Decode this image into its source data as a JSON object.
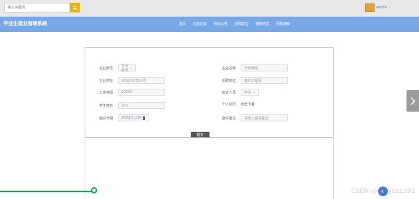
{
  "search": {
    "placeholder": "输入关键词"
  },
  "user": {
    "name": "admin"
  },
  "nav": {
    "brand": "毕业生就业管理系统",
    "items": [
      "首页",
      "交流论坛",
      "网站公告",
      "招聘职位",
      "招聘信息",
      "招聘通知"
    ]
  },
  "form": {
    "left": [
      {
        "label": "企业账号",
        "type": "select",
        "value": "企业账号"
      },
      {
        "label": "企业地址",
        "type": "text",
        "value": "XX省XX市XX号"
      },
      {
        "label": "工资待遇",
        "type": "text",
        "value": "10000"
      },
      {
        "label": "学生姓名",
        "type": "text",
        "value": "张三"
      },
      {
        "label": "面试日期",
        "type": "date",
        "value": "2023/11/16"
      }
    ],
    "right": [
      {
        "label": "企业名称",
        "type": "text",
        "value": "华软网络"
      },
      {
        "label": "招聘岗位",
        "type": "text",
        "value": "软件工程师"
      },
      {
        "label": "面试人员",
        "type": "select",
        "value": "学生"
      },
      {
        "label": "个人简历",
        "type": "link",
        "value": "点击下载"
      },
      {
        "label": "面试备注",
        "type": "text",
        "value": "请输入面试备注"
      }
    ],
    "submit_label": "提交"
  },
  "watermark": {
    "text_left": "CSDN @",
    "badge": "k",
    "text_right": "ybs1991"
  },
  "colors": {
    "navbar": "#7aa7e8",
    "search_button": "#f0b400",
    "progress": "#19a25a"
  },
  "progress": {
    "fraction": 0.22
  }
}
